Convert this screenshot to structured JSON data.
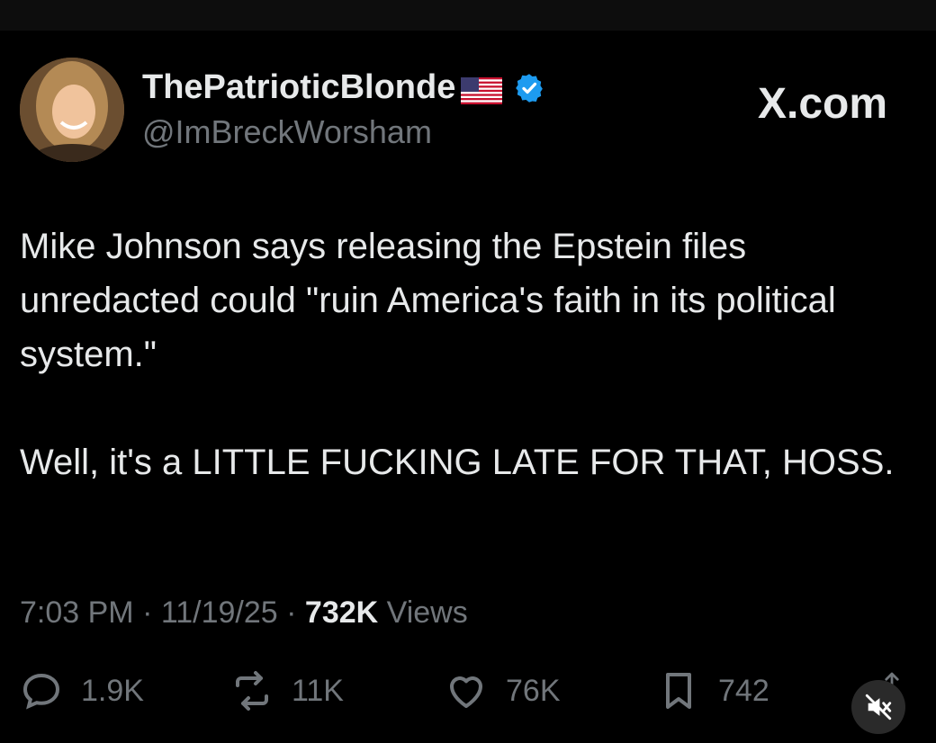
{
  "tweet": {
    "display_name": "ThePatrioticBlonde",
    "handle": "@ImBreckWorsham",
    "brand": "X.com",
    "text": "Mike Johnson says releasing the Epstein files unredacted could \"ruin America's faith in its political system.\"\n\nWell, it's a LITTLE FUCKING LATE FOR THAT, HOSS.",
    "time": "7:03 PM",
    "date": "11/19/25",
    "views_count": "732K",
    "views_label": "Views"
  },
  "actions": {
    "replies": "1.9K",
    "reposts": "11K",
    "likes": "76K",
    "bookmarks": "742"
  },
  "icons": {
    "avatar": "avatar",
    "flag": "us-flag-icon",
    "verified": "verified-badge-icon",
    "reply": "reply-icon",
    "repost": "repost-icon",
    "like": "heart-icon",
    "bookmark": "bookmark-icon",
    "mute": "muted-speaker-icon",
    "share": "share-icon"
  },
  "colors": {
    "background": "#000000",
    "text": "#e7e9ea",
    "secondary": "#71767b",
    "verified": "#1d9bf0"
  }
}
